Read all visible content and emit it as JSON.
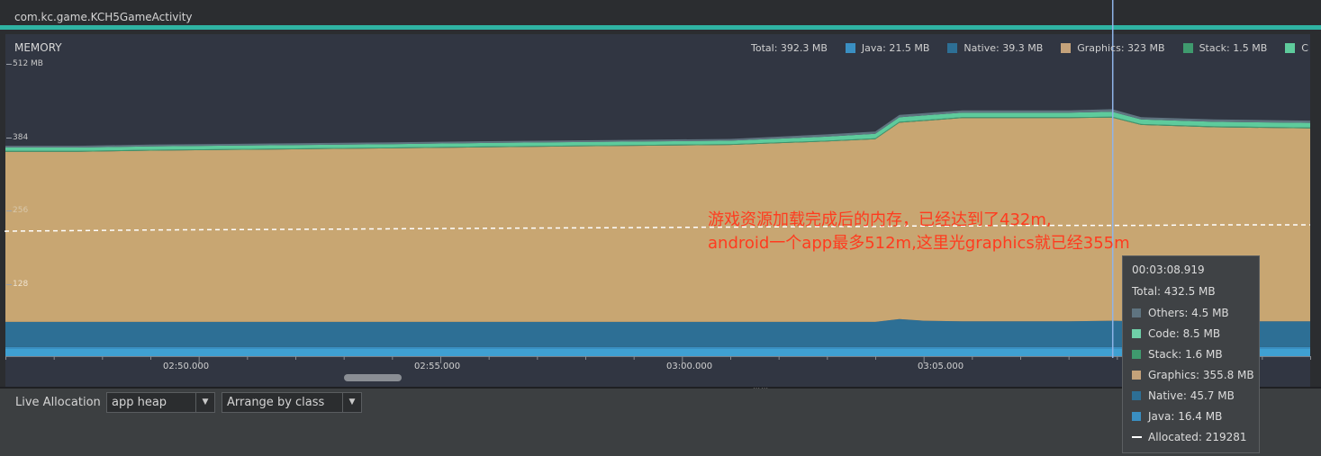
{
  "process": {
    "name": "com.kc.game.KCH5GameActivity"
  },
  "memory": {
    "title": "MEMORY",
    "legend": [
      {
        "label": "Total: 392.3 MB",
        "color": ""
      },
      {
        "label": "Java: 21.5 MB",
        "color": "#3a8fc2"
      },
      {
        "label": "Native: 39.3 MB",
        "color": "#2d6f95"
      },
      {
        "label": "Graphics: 323 MB",
        "color": "#c4a27a"
      },
      {
        "label": "Stack: 1.5 MB",
        "color": "#3f9a6e"
      },
      {
        "label": "C",
        "color": "#5ecb9c"
      }
    ],
    "y_ticks": [
      "512 MB",
      "384",
      "256",
      "128"
    ],
    "x_ticks": [
      "02:50.000",
      "02:55.000",
      "03:00.000",
      "03:05.000"
    ]
  },
  "chart_data": {
    "type": "area",
    "x": [
      "02:46.0",
      "02:47.5",
      "02:49.0",
      "02:51.5",
      "02:54.0",
      "02:56.0",
      "02:58.5",
      "03:01.0",
      "03:03.0",
      "03:04.0",
      "03:04.5",
      "03:05.0",
      "03:05.8",
      "03:07.0",
      "03:08.0",
      "03:08.9",
      "03:09.5",
      "03:11.0",
      "03:13.0"
    ],
    "ylim": [
      0,
      512
    ],
    "y_unit": "MB",
    "series": [
      {
        "name": "Java",
        "values": [
          16,
          16,
          16,
          16,
          16,
          16,
          16,
          16,
          16,
          16,
          16,
          16,
          16,
          16,
          16,
          16,
          16,
          16,
          16
        ]
      },
      {
        "name": "Native",
        "values": [
          44,
          44,
          44,
          44,
          44,
          44,
          44,
          44,
          44,
          44,
          49,
          46,
          45,
          45,
          45,
          46,
          45,
          45,
          45
        ]
      },
      {
        "name": "Graphics",
        "values": [
          298,
          298,
          300,
          302,
          304,
          306,
          308,
          310,
          316,
          320,
          344,
          350,
          356,
          356,
          356,
          356,
          344,
          340,
          338
        ]
      },
      {
        "name": "Stack",
        "values": [
          1.5,
          1.5,
          1.5,
          1.5,
          1.5,
          1.5,
          1.5,
          1.5,
          1.5,
          1.5,
          1.5,
          1.5,
          1.6,
          1.6,
          1.6,
          1.6,
          1.6,
          1.6,
          1.6
        ]
      },
      {
        "name": "Code",
        "values": [
          6,
          6,
          6,
          6,
          6,
          6,
          6,
          6,
          7,
          8,
          8,
          8,
          8,
          8,
          8,
          8.5,
          8,
          8,
          8
        ]
      },
      {
        "name": "Others",
        "values": [
          3,
          3,
          3,
          3,
          3,
          3,
          3,
          3,
          4,
          4,
          4,
          4,
          4,
          4,
          4,
          4.5,
          4,
          4,
          4
        ]
      },
      {
        "name": "Allocated",
        "values": [
          219,
          220,
          221,
          222,
          223,
          224,
          225,
          226,
          227,
          227,
          228,
          228,
          228,
          229,
          229,
          229,
          229,
          230,
          230
        ]
      }
    ],
    "selected_time": "03:08.9"
  },
  "timeline": {
    "scrollbar": ""
  },
  "annotation": {
    "line1": "游戏资源加载完成后的内存，已经达到了432m,",
    "line2": "android一个app最多512m,这里光graphics就已经355m"
  },
  "tooltip": {
    "time": "00:03:08.919",
    "total": "Total: 432.5 MB",
    "rows": [
      {
        "label": "Others: 4.5 MB",
        "color": "#5f7480"
      },
      {
        "label": "Code: 8.5 MB",
        "color": "#6fd0a8"
      },
      {
        "label": "Stack: 1.6 MB",
        "color": "#3f9a6e"
      },
      {
        "label": "Graphics: 355.8 MB",
        "color": "#c4a27a"
      },
      {
        "label": "Native: 45.7 MB",
        "color": "#2d6f95"
      },
      {
        "label": "Java: 16.4 MB",
        "color": "#3a8fc2"
      }
    ],
    "allocated": "Allocated: 219281"
  },
  "allocation": {
    "label": "Live Allocation",
    "heap_select": "app heap",
    "arrange_select": "Arrange by class"
  }
}
